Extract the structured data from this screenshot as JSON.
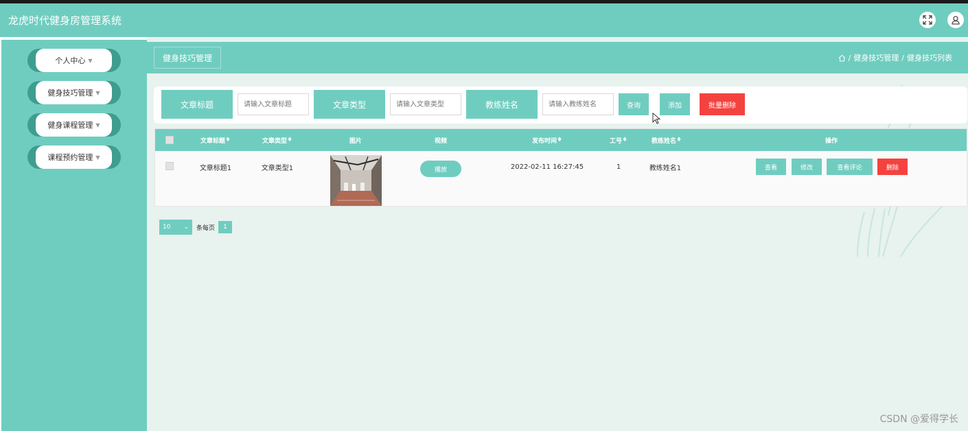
{
  "app": {
    "title": "龙虎时代健身房管理系统",
    "header_icons": [
      "fullscreen-icon",
      "user-icon"
    ]
  },
  "sidebar": {
    "items": [
      {
        "label": "个人中心"
      },
      {
        "label": "健身技巧管理"
      },
      {
        "label": "健身课程管理"
      },
      {
        "label": "课程预约管理"
      }
    ]
  },
  "page": {
    "tab_label": "健身技巧管理",
    "breadcrumb": [
      "健身技巧管理",
      "健身技巧列表"
    ],
    "breadcrumb_separator": "/"
  },
  "search": {
    "fields": [
      {
        "label": "文章标题",
        "placeholder": "请输入文章标题"
      },
      {
        "label": "文章类型",
        "placeholder": "请输入文章类型"
      },
      {
        "label": "教练姓名",
        "placeholder": "请输入教练姓名"
      }
    ],
    "query_button": "查询",
    "add_button": "添加",
    "batch_delete_button": "批量删除"
  },
  "table": {
    "columns": [
      "文章标题",
      "文章类型",
      "图片",
      "视频",
      "发布时间",
      "工号",
      "教练姓名",
      "操作"
    ],
    "sortable_marker": "♦",
    "rows": [
      {
        "title": "文章标题1",
        "type": "文章类型1",
        "video_button": "播放",
        "publish_time": "2022-02-11 16:27:45",
        "job_no": "1",
        "coach_name": "教练姓名1",
        "actions": [
          "查看",
          "修改",
          "查看评论",
          "删除"
        ]
      }
    ]
  },
  "pagination": {
    "page_size": "10",
    "page_size_label": "条每页",
    "current_page": "1"
  },
  "watermark": "CSDN @爱得学长",
  "colors": {
    "primary": "#6fcdc0",
    "menu_ring": "#3f9d8f",
    "danger": "#f4433f",
    "content_bg": "#e8f2ee"
  }
}
